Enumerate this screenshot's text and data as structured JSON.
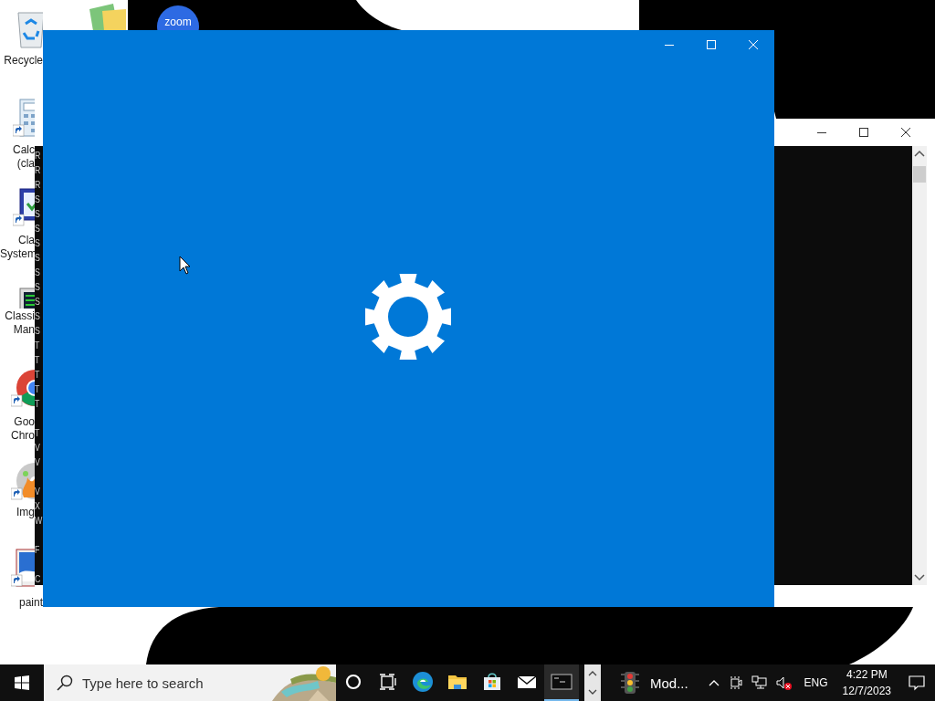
{
  "desktop_icons": [
    {
      "kind": "recycle",
      "lines": [
        "Recycle"
      ]
    },
    {
      "kind": "photos"
    },
    {
      "kind": "zoom",
      "logo_text": "zoom"
    },
    {
      "kind": "calculator",
      "lines": [
        "Calc",
        "(cla"
      ]
    },
    {
      "kind": "checklist",
      "lines": [
        "Cla",
        "System"
      ]
    },
    {
      "kind": "terminal",
      "lines": [
        "Classi",
        "Man"
      ]
    },
    {
      "kind": "chrome",
      "lines": [
        "Goo",
        "Chro"
      ]
    },
    {
      "kind": "burner",
      "lines": [
        "Img"
      ]
    },
    {
      "kind": "paint",
      "lines": [
        "paint"
      ]
    }
  ],
  "console_window": {
    "blocks": [
      [
        "R",
        "R",
        "R",
        "S",
        "S",
        "S",
        "S",
        "S",
        "S",
        "S",
        "S",
        "S",
        "S",
        "T",
        "T",
        "T",
        "T",
        "T"
      ],
      [
        "T",
        "V",
        "V"
      ],
      [
        "V",
        "X",
        "W"
      ],
      [
        "F"
      ],
      [
        "C"
      ]
    ]
  },
  "taskbar": {
    "search": {
      "placeholder": "Type here to search"
    },
    "apps": [
      {
        "kind": "cortana",
        "running": false
      },
      {
        "kind": "task-view",
        "running": false
      },
      {
        "kind": "edge",
        "running": false
      },
      {
        "kind": "explorer",
        "running": false
      },
      {
        "kind": "store",
        "running": false
      },
      {
        "kind": "mail",
        "running": false
      },
      {
        "kind": "terminal",
        "running": true
      }
    ],
    "window_button": {
      "kind": "traffic-light",
      "label": "Mod..."
    },
    "tray": {
      "speaker_muted": true,
      "language": "ENG",
      "time": "4:22 PM",
      "date": "12/7/2023"
    }
  }
}
